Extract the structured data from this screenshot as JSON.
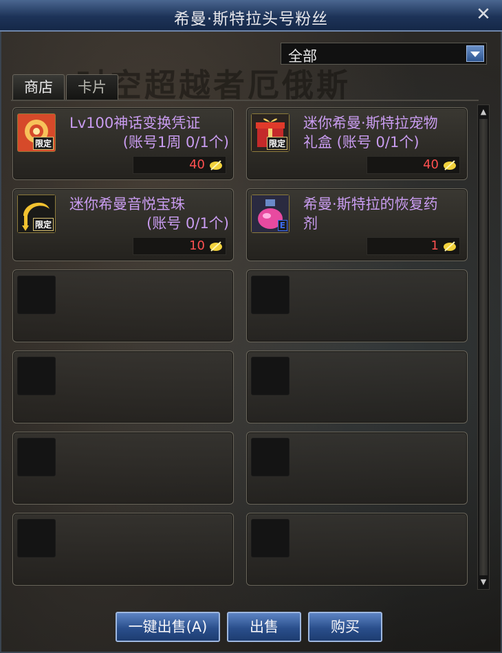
{
  "window": {
    "title": "希曼·斯特拉头号粉丝",
    "close_label": "✕"
  },
  "banner": "时空超越者厄俄斯",
  "filter": {
    "selected": "全部"
  },
  "tabs": [
    {
      "label": "商店"
    },
    {
      "label": "卡片"
    }
  ],
  "items": [
    {
      "line1": "Lv100神话变换凭证",
      "line2": "(账号1周 0/1个)",
      "price": "40",
      "badge": "限定",
      "icon": "golden-ring-icon"
    },
    {
      "line1": "迷你希曼·斯特拉宠物",
      "line2": "礼盒    (账号 0/1个)",
      "price": "40",
      "badge": "限定",
      "icon": "gift-box-icon"
    },
    {
      "line1": "迷你希曼音悦宝珠",
      "line2": "(账号 0/1个)",
      "price": "10",
      "badge": "限定",
      "icon": "golden-orb-icon"
    },
    {
      "line1": "希曼·斯特拉的恢复药",
      "line2": "剂",
      "price": "1",
      "badge": "E",
      "icon": "potion-icon"
    }
  ],
  "buttons": {
    "sell_all": "一键出售(A)",
    "sell": "出售",
    "buy": "购买"
  },
  "colors": {
    "item_name": "#c99cf0",
    "price": "#ff5050",
    "title_bar": "#1d3358"
  }
}
